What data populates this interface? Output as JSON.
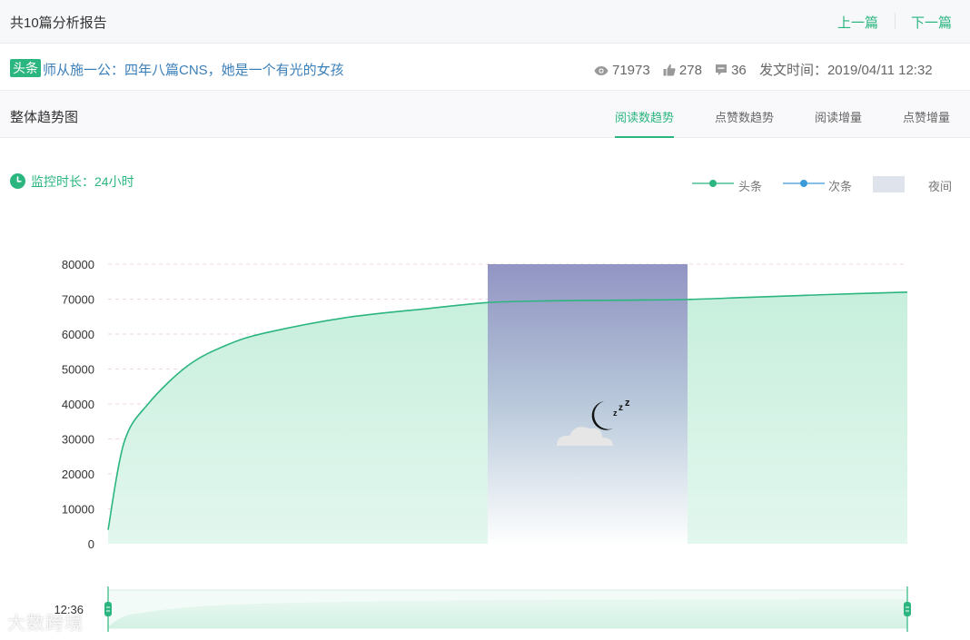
{
  "header": {
    "title": "共10篇分析报告",
    "prev_label": "上一篇",
    "next_label": "下一篇"
  },
  "article": {
    "tag": "头条",
    "title": "师从施一公：四年八篇CNS，她是一个有光的女孩",
    "views": "71973",
    "likes": "278",
    "comments": "36",
    "publish_label": "发文时间：",
    "publish_time": "2019/04/11 12:32"
  },
  "section": {
    "title": "整体趋势图",
    "tabs": [
      {
        "label": "阅读数趋势",
        "active": true
      },
      {
        "label": "点赞数趋势",
        "active": false
      },
      {
        "label": "阅读增量",
        "active": false
      },
      {
        "label": "点赞增量",
        "active": false
      }
    ]
  },
  "monitor": {
    "label": "监控时长：24小时"
  },
  "legend": {
    "items": [
      "头条",
      "次条",
      "夜间"
    ]
  },
  "colors": {
    "primary": "#2bb57f",
    "secondary": "#3a9ad9",
    "night": "#8c8fc0",
    "link": "#3b7fb8"
  },
  "chart_data": {
    "type": "area",
    "ylim": [
      0,
      80000
    ],
    "yticks": [
      "80000",
      "70000",
      "60000",
      "50000",
      "40000",
      "30000",
      "20000",
      "10000",
      "0"
    ],
    "slider_start_label": "12:36",
    "night_band": [
      0.475,
      0.725
    ],
    "series": [
      {
        "name": "头条",
        "x": [
          0,
          0.02,
          0.05,
          0.1,
          0.15,
          0.2,
          0.3,
          0.4,
          0.475,
          0.55,
          0.65,
          0.725,
          0.8,
          0.9,
          1.0
        ],
        "values": [
          4000,
          29000,
          40000,
          51000,
          57000,
          60500,
          64800,
          67300,
          69000,
          69500,
          69700,
          69900,
          70500,
          71300,
          72000
        ]
      }
    ]
  }
}
